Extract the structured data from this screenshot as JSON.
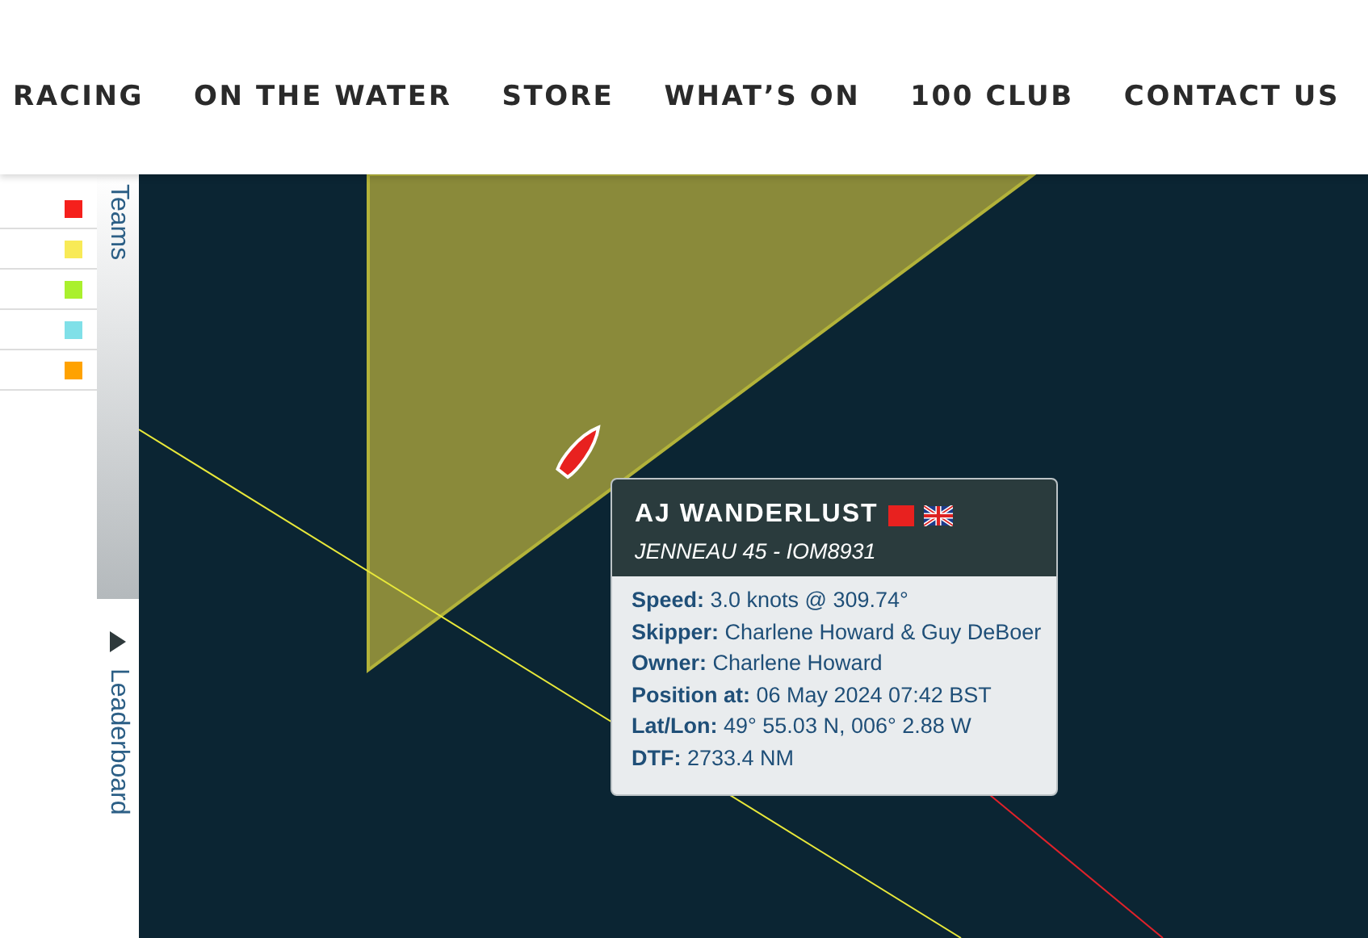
{
  "nav": [
    "RACING",
    "ON THE WATER",
    "STORE",
    "WHAT’S ON",
    "100 CLUB",
    "CONTACT US"
  ],
  "tabs": [
    {
      "label": "Teams",
      "selected": true
    },
    {
      "label": "Leaderboard",
      "selected": false
    }
  ],
  "teams": [
    {
      "color": "#f5201c"
    },
    {
      "color": "#f8ea57"
    },
    {
      "color": "#aaf02e"
    },
    {
      "color": "#80e0e8"
    },
    {
      "color": "#ffa200"
    }
  ],
  "tooltip": {
    "name": "AJ WANDERLUST",
    "color": "#e8211f",
    "subtitle": "JENNEAU 45 - IOM8931",
    "lines": [
      "**Speed:** 3.0 knots @ 309.74°",
      "**Skipper:** Charlene Howard & Guy DeBoer",
      "**Owner:** Charlene Howard",
      "**Position at:** 06 May 2024 07:42 BST",
      "**Lat/Lon:** 49° 55.03 N, 006° 2.88 W",
      "**DTF:** 2733.4 NM"
    ]
  }
}
